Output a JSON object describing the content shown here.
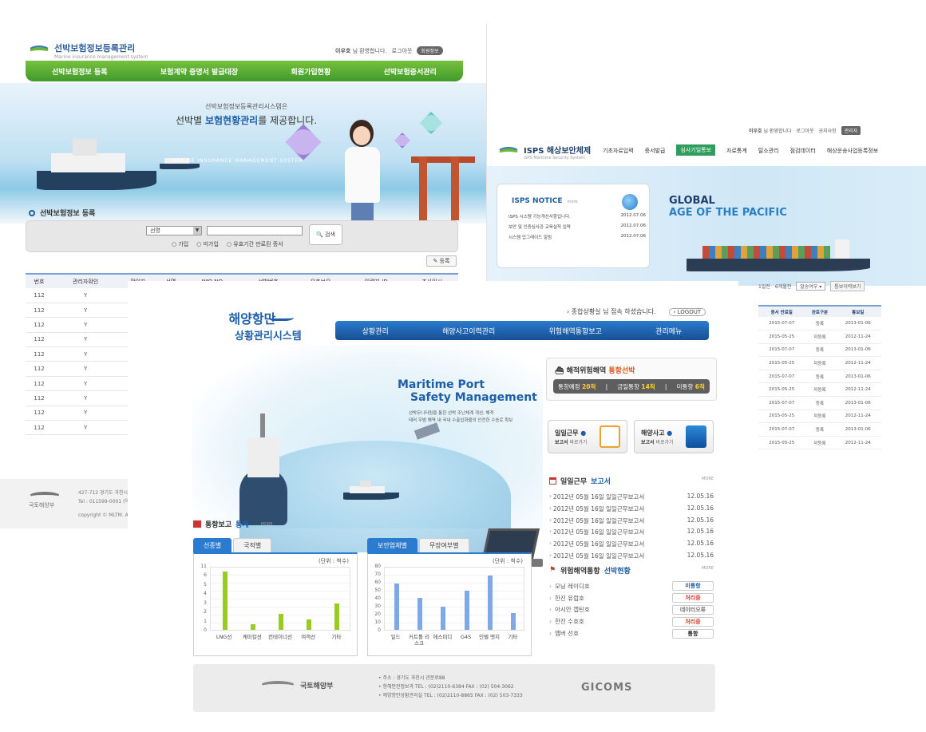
{
  "shotA": {
    "brand": "선박보험정보등록관리",
    "brand_sub": "Marine insurance management system",
    "user": "이우호",
    "user_suffix": "님 환영합니다.",
    "logout": "로그아웃",
    "member_info": "회원정보",
    "nav": [
      "선박보험정보 등록",
      "보험계약 증명서 발급대장",
      "회원가입현황",
      "선박보험증서관리"
    ],
    "hero_line1": "선박보험정보등록관리시스템은",
    "hero_line2_pre": "선박별",
    "hero_line2_bold": "보험현황관리",
    "hero_line2_post": "를 제공합니다.",
    "hero_caption": "MARINE INSURANCE MANAGEMENT SYSTEM",
    "section_title": "선박보험정보 등록",
    "search_select": "선명",
    "search_button": "검색",
    "radios": [
      "가입",
      "미가입",
      "유효기간 만료된 증서"
    ],
    "register_button": "등록",
    "columns": [
      "번호",
      "관리자확인",
      "확인자",
      "선명",
      "IMO NO.",
      "선박번호",
      "유효보유",
      "입력자 ID",
      "조사일시"
    ],
    "rows": [
      [
        "112",
        "Y"
      ],
      [
        "112",
        "Y"
      ],
      [
        "112",
        "Y"
      ],
      [
        "112",
        "Y"
      ],
      [
        "112",
        "Y"
      ],
      [
        "112",
        "Y"
      ],
      [
        "112",
        "Y"
      ],
      [
        "112",
        "Y"
      ],
      [
        "112",
        "Y"
      ],
      [
        "112",
        "Y"
      ]
    ],
    "footer_logo": "국토해양부",
    "footer_addr1": "427-712 경기도 과천시",
    "footer_addr2": "Tel : 011599-0001 (약",
    "footer_copy": "copyright © MLTM. All"
  },
  "shotB": {
    "user": "이우호",
    "user_suffix": "님 환영합니다",
    "logout": "로그아웃",
    "notice": "공지사항",
    "admin": "관리자",
    "brand": "ISPS 해상보안체제",
    "brand_sub": "ISPS Maritime Security System",
    "nav": [
      "기초자료입력",
      "증서발급",
      "심사기일통보",
      "자료통계",
      "탈소관리",
      "점검데이터",
      "해상운송사업등록정보"
    ],
    "nav_active_index": 2,
    "notice_title": "ISPS NOTICE",
    "notice_more": "more",
    "notices": [
      {
        "title": "ISPS 시스템 기능개선사항입니다.",
        "date": "2012.07.06"
      },
      {
        "title": "보안 및 인증심사관 교육실적 입력",
        "date": "2012.07.06"
      },
      {
        "title": "시스템 업그레이드 알림",
        "date": "2012.07.06"
      }
    ],
    "global_line1": "GLOBAL",
    "global_line2": "AGE OF THE PACIFIC",
    "filter_left": "1일전",
    "filter_mid": "6개월전",
    "filter_select": "발송여부",
    "filter_button": "통보이력보기",
    "columns": [
      "증서 만료일",
      "완료구분",
      "통보일"
    ],
    "rows": [
      [
        "2015-07-07",
        "등록",
        "2013-01-06"
      ],
      [
        "2015-05-25",
        "미등록",
        "2012-11-24"
      ],
      [
        "2015-07-07",
        "등록",
        "2013-01-06"
      ],
      [
        "2015-05-25",
        "미등록",
        "2012-11-24"
      ],
      [
        "2015-07-07",
        "등록",
        "2013-01-06"
      ],
      [
        "2015-05-25",
        "미등록",
        "2012-11-24"
      ],
      [
        "2015-07-07",
        "등록",
        "2013-01-06"
      ],
      [
        "2015-05-25",
        "미등록",
        "2012-11-24"
      ],
      [
        "2015-07-07",
        "등록",
        "2013-01-06"
      ],
      [
        "2015-05-25",
        "미등록",
        "2012-11-24"
      ]
    ]
  },
  "shotC": {
    "brand_line1": "해양항만",
    "brand_line2": "상황관리시스템",
    "user_msg": "› 종합상황실 님 접속 하셨습니다.",
    "logout": "LOGOUT",
    "nav": [
      "상황관리",
      "해양사고이력관리",
      "위험해역통항보고",
      "관리메뉴"
    ],
    "visual_title1": "Maritime Port",
    "visual_title2": "Safety Management",
    "visual_desc1": "선박모니터링을 통한 선박 조난체계 개선, 해적",
    "visual_desc2": "테러 우범 해역 내 국내 수출입화물의 안전한 수송로 확보",
    "pirate_title_pre": "해적위험해역",
    "pirate_title_accent": "통항선박",
    "pirate_items": [
      {
        "label": "통항예정",
        "value": "20척"
      },
      {
        "label": "금일통항",
        "value": "14척"
      },
      {
        "label": "미통항",
        "value": "6척"
      }
    ],
    "quick1_title": "일일근무",
    "quick1_sub_bold": "보고서",
    "quick1_sub": "바로가기",
    "quick2_title": "해양사고",
    "quick2_sub_bold": "보고서",
    "quick2_sub": "바로가기",
    "daily_title_pre": "일일근무",
    "daily_title_accent": "보고서",
    "more": "MORE",
    "daily_items": [
      {
        "title": "2012년 05월 16일 일일근무보고서",
        "date": "12.05.16"
      },
      {
        "title": "2012년 05월 16일 일일근무보고서",
        "date": "12.05.16"
      },
      {
        "title": "2012년 05월 16일 일일근무보고서",
        "date": "12.05.16"
      },
      {
        "title": "2012년 05월 16일 일일근무보고서",
        "date": "12.05.16"
      },
      {
        "title": "2012년 05월 16일 일일근무보고서",
        "date": "12.05.16"
      },
      {
        "title": "2012년 05월 16일 일일근무보고서",
        "date": "12.05.16"
      }
    ],
    "danger_title_pre": "위험해역통항",
    "danger_title_accent": "선박현황",
    "danger_items": [
      {
        "name": "모닝 레이디호",
        "status": "미통항",
        "color": "#1e5fa8"
      },
      {
        "name": "한진 유럽호",
        "status": "처리중",
        "color": "#d23a2a"
      },
      {
        "name": "아시안 캡틴호",
        "status": "데이터오류",
        "color": "#777777"
      },
      {
        "name": "한진 수호호",
        "status": "처리중",
        "color": "#d23a2a"
      },
      {
        "name": "엠버 선호",
        "status": "통항",
        "color": "#222222"
      }
    ],
    "stats_title_pre": "통항보고",
    "stats_title_accent": "통계",
    "footer_logo": "국토해양부",
    "footer_addr": "• 주소 : 경기도 과천시 관문로88",
    "footer_l1": "• 항해안전정보과     TEL : (02)2110-6384   FAX : (02) 504-3062",
    "footer_l2": "• 해양항만상황관리실   TEL : (02)2110-8865   FAX : (02) 503-7333",
    "footer_brand": "GICOMS"
  },
  "chart_data": [
    {
      "type": "bar",
      "tabs": [
        "선종별",
        "국적별"
      ],
      "active_tab": 0,
      "unit": "(단위 : 척수)",
      "categories": [
        "LNG선",
        "케미칼선",
        "컨테이너선",
        "여객선",
        "기타"
      ],
      "values": [
        11,
        1,
        3,
        2,
        5
      ],
      "ylim": [
        0,
        12
      ],
      "yticks": [
        "11",
        "6",
        "5",
        "4",
        "3",
        "2",
        "1",
        "0"
      ],
      "color": "#99cc22"
    },
    {
      "type": "bar",
      "tabs": [
        "보안업체별",
        "무장여부별"
      ],
      "active_tab": 0,
      "unit": "(단위 : 척수)",
      "categories": [
        "일드",
        "커트롤 리스크",
        "에스피디",
        "G4S",
        "인텔 엣지",
        "기타"
      ],
      "values": [
        62,
        42,
        31,
        52,
        72,
        22
      ],
      "ylim": [
        0,
        85
      ],
      "yticks": [
        "80",
        "70",
        "60",
        "50",
        "40",
        "30",
        "20",
        "10",
        "0"
      ],
      "color": "#7fa8e8"
    }
  ]
}
